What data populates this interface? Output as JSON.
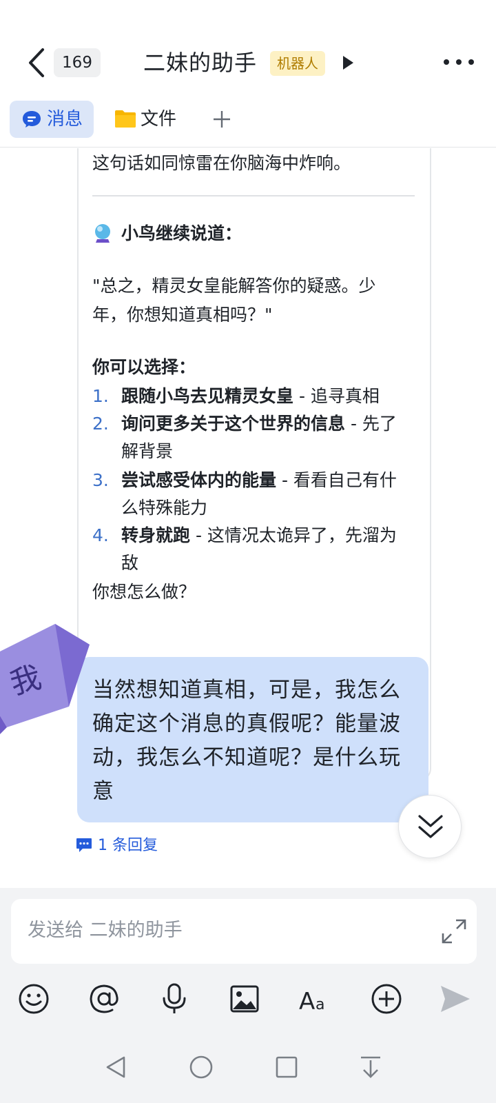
{
  "header": {
    "unread_count": "169",
    "title": "二妹的助手",
    "robot_tag": "机器人"
  },
  "tabs": [
    {
      "label": "消息",
      "icon": "message-bubble-icon",
      "active": true
    },
    {
      "label": "文件",
      "icon": "folder-icon",
      "active": false
    }
  ],
  "bot_message": {
    "top_line": "这句话如同惊雷在你脑海中炸响。",
    "speaker_icon": "crystal-ball-icon",
    "speaker_line": "小鸟继续说道：",
    "quote_line1": "\"总之，精灵女皇能解答你的疑惑。少",
    "quote_line2": "年，你想知道真相吗？\"",
    "choose_title": "你可以选择：",
    "options": [
      {
        "num": "1.",
        "bold": "跟随小鸟去见精灵女皇",
        "rest": " - 追寻真相"
      },
      {
        "num": "2.",
        "bold": "询问更多关于这个世界的信息",
        "rest": " - 先了解背景"
      },
      {
        "num": "3.",
        "bold": "尝试感受体内的能量",
        "rest": " - 看看自己有什么特殊能力"
      },
      {
        "num": "4.",
        "bold": "转身就跑",
        "rest": " - 这情况太诡异了，先溜为敌"
      }
    ],
    "closing": "你想怎么做？"
  },
  "my_message": {
    "avatar_label": "我",
    "text": "当然想知道真相，可是，我怎么确定这个消息的真假呢？能量波动，我怎么不知道呢？是什么玩意"
  },
  "reply_link": "1 条回复",
  "composer": {
    "placeholder": "发送给 二妹的助手",
    "toolbar_icons": [
      "emoji-icon",
      "mention-icon",
      "microphone-icon",
      "image-icon",
      "text-format-icon",
      "add-icon",
      "send-icon"
    ]
  },
  "colors": {
    "accent": "#245bdb",
    "my_bubble": "#cfe0fb",
    "robot_tag_bg": "#fdf1c4",
    "robot_tag_text": "#b07d00",
    "option_number": "#3c70c8"
  }
}
